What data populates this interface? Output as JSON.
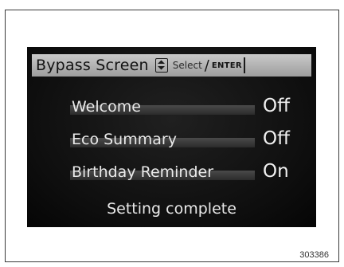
{
  "header": {
    "title": "Bypass Screen",
    "select_label": "Select",
    "slash": "/",
    "enter_label": "ENTER"
  },
  "items": [
    {
      "label": "Welcome",
      "value": "Off"
    },
    {
      "label": "Eco Summary",
      "value": "Off"
    },
    {
      "label": "Birthday Reminder",
      "value": "On"
    }
  ],
  "status": "Setting complete",
  "figure_code": "303386",
  "icons": {
    "updown": "up-down-arrow-icon"
  },
  "colors": {
    "screen_bg": "#0e0e0e",
    "header_bg": "#b5b5b5",
    "text": "#eaeaea"
  }
}
